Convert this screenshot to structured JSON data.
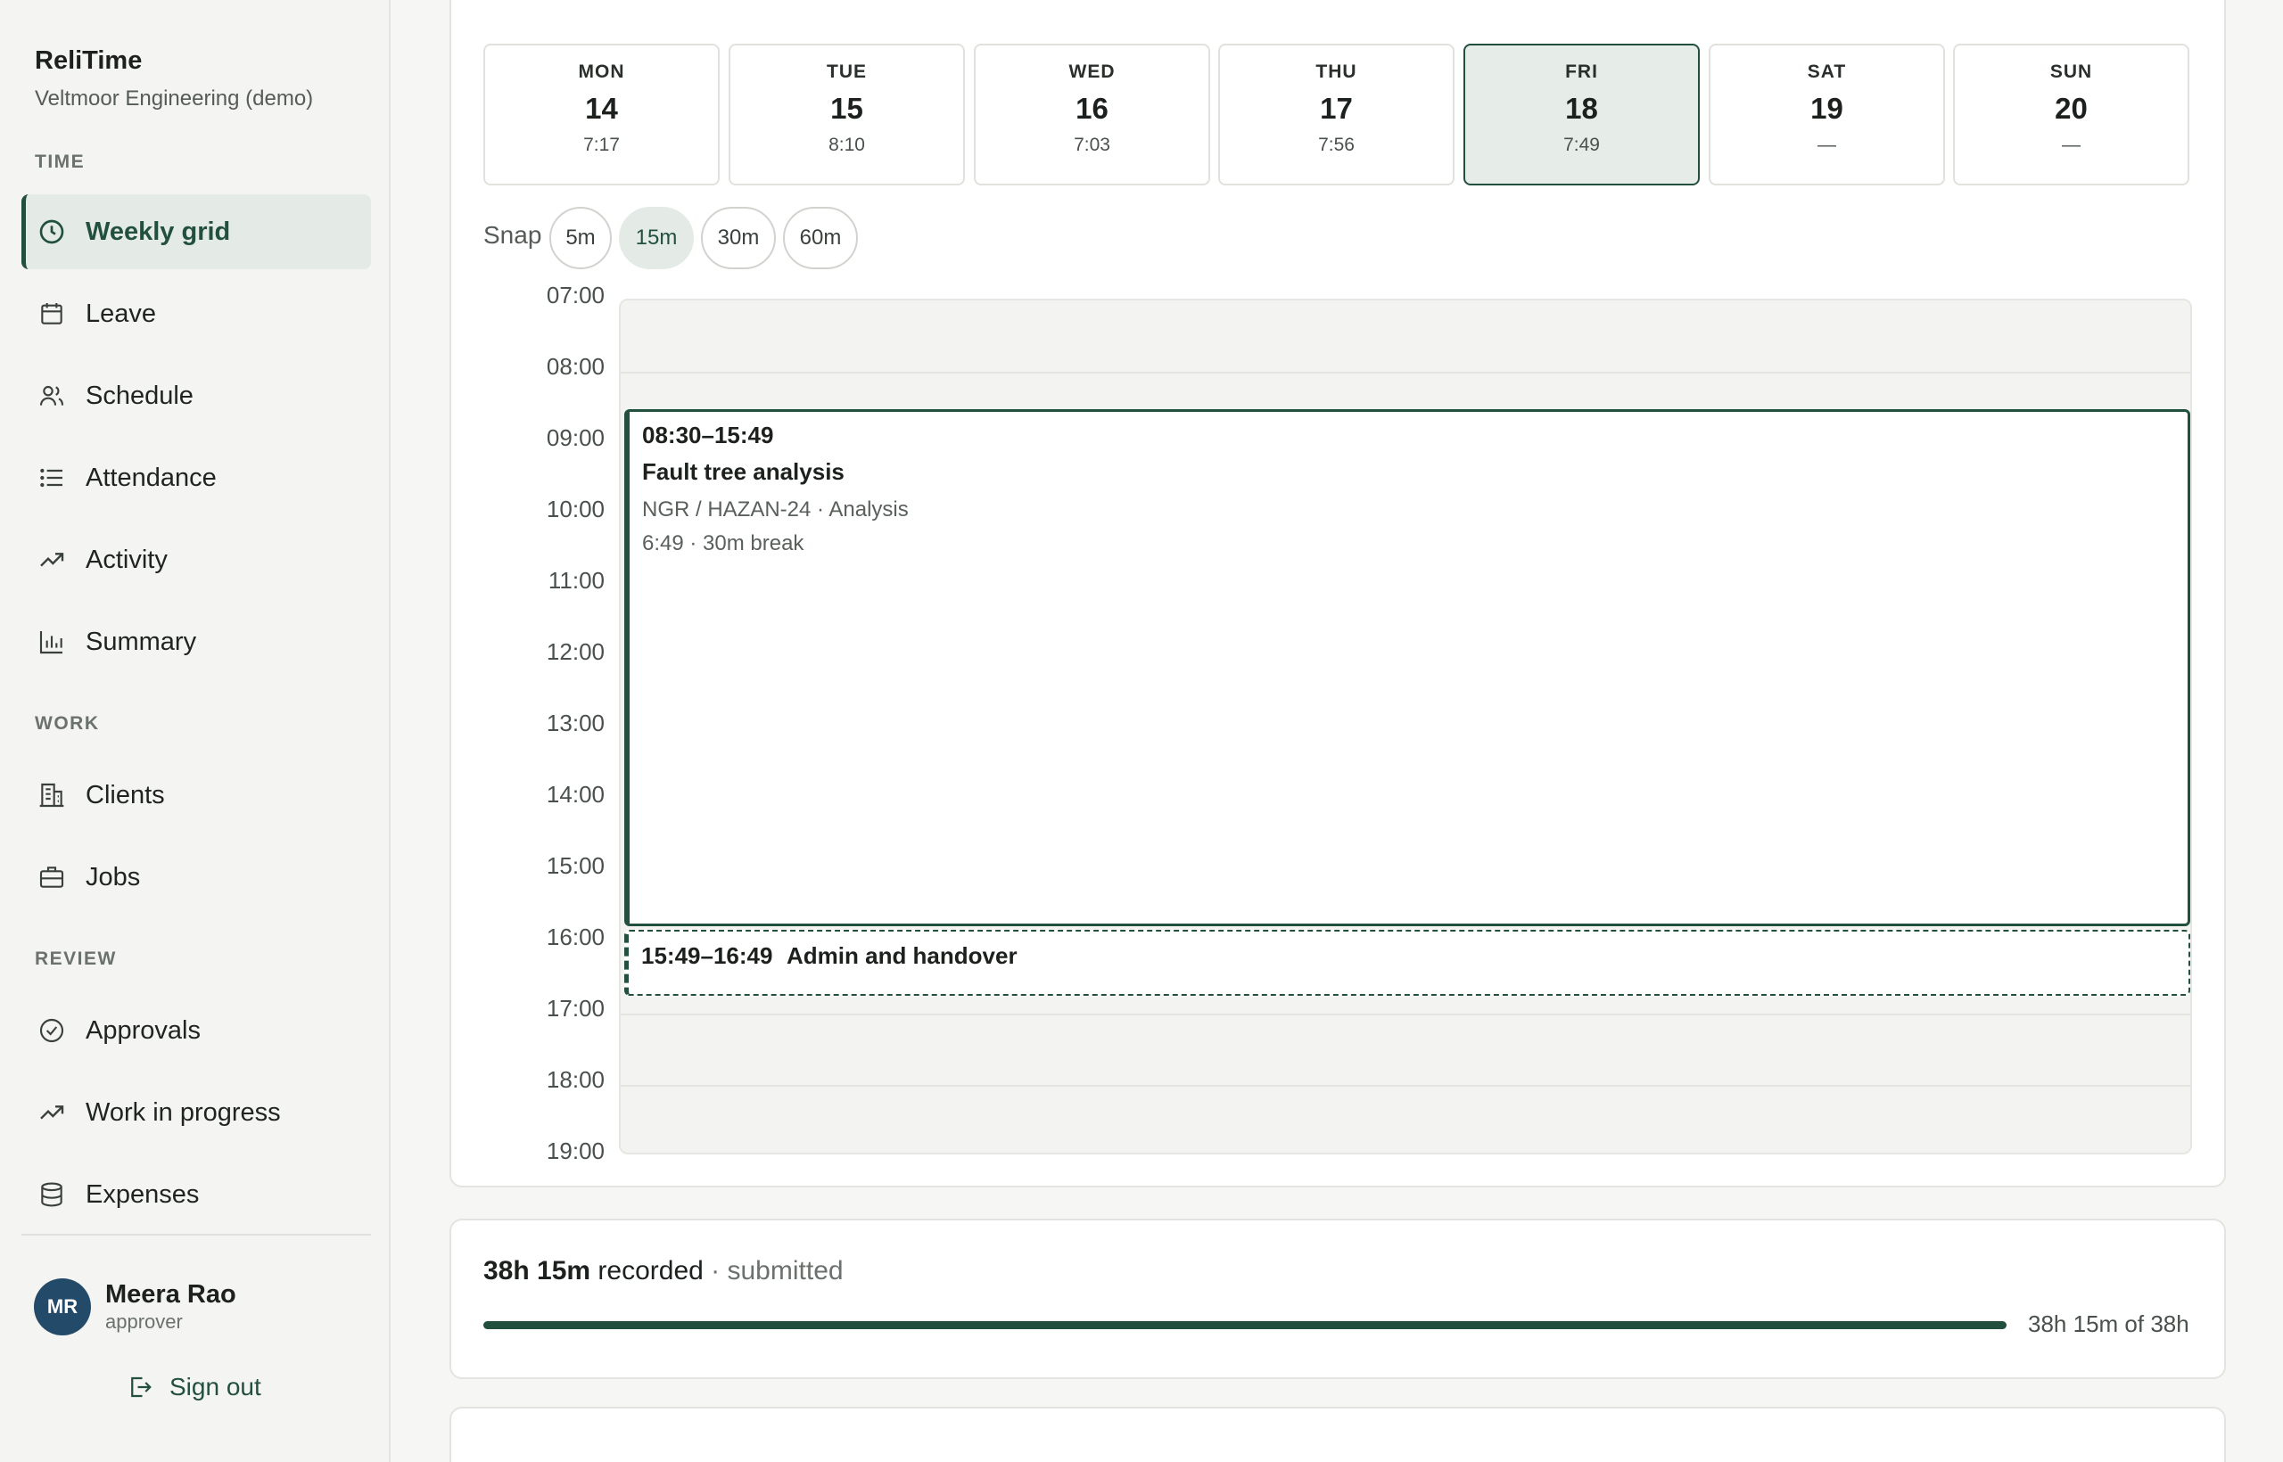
{
  "app": {
    "name": "ReliTime",
    "organization": "Veltmoor Engineering (demo)"
  },
  "sidebar": {
    "sections": [
      {
        "label": "TIME",
        "items": [
          {
            "label": "Weekly grid",
            "icon": "clock-icon",
            "active": true
          },
          {
            "label": "Leave",
            "icon": "calendar-icon"
          },
          {
            "label": "Schedule",
            "icon": "users-icon"
          },
          {
            "label": "Attendance",
            "icon": "list-icon"
          },
          {
            "label": "Activity",
            "icon": "trend-up-icon"
          },
          {
            "label": "Summary",
            "icon": "bar-chart-icon"
          }
        ]
      },
      {
        "label": "WORK",
        "items": [
          {
            "label": "Clients",
            "icon": "building-icon"
          },
          {
            "label": "Jobs",
            "icon": "briefcase-icon"
          }
        ]
      },
      {
        "label": "REVIEW",
        "items": [
          {
            "label": "Approvals",
            "icon": "check-circle-icon"
          },
          {
            "label": "Work in progress",
            "icon": "trend-up-icon"
          },
          {
            "label": "Expenses",
            "icon": "database-icon"
          }
        ]
      }
    ]
  },
  "user": {
    "initials": "MR",
    "name": "Meera Rao",
    "role": "approver",
    "signout_label": "Sign out"
  },
  "week": {
    "days": [
      {
        "name": "MON",
        "num": "14",
        "hours": "7:17"
      },
      {
        "name": "TUE",
        "num": "15",
        "hours": "8:10"
      },
      {
        "name": "WED",
        "num": "16",
        "hours": "7:03"
      },
      {
        "name": "THU",
        "num": "17",
        "hours": "7:56"
      },
      {
        "name": "FRI",
        "num": "18",
        "hours": "7:49",
        "active": true
      },
      {
        "name": "SAT",
        "num": "19",
        "hours": "—"
      },
      {
        "name": "SUN",
        "num": "20",
        "hours": "—"
      }
    ],
    "snap_label": "Snap",
    "snap_options": [
      "5m",
      "15m",
      "30m",
      "60m"
    ],
    "snap_selected": "15m",
    "time_labels": [
      "07:00",
      "08:00",
      "09:00",
      "10:00",
      "11:00",
      "12:00",
      "13:00",
      "14:00",
      "15:00",
      "16:00",
      "17:00",
      "18:00",
      "19:00"
    ]
  },
  "entries": {
    "main": {
      "time_range": "08:30–15:49",
      "title": "Fault tree analysis",
      "meta": "NGR / HAZAN-24 · Analysis",
      "duration": "6:49 · 30m break"
    },
    "gap": {
      "time_range": "15:49–16:49",
      "title": "Admin and handover"
    }
  },
  "totals": {
    "recorded": "38h 15m",
    "recorded_suffix": "recorded",
    "status": "· submitted",
    "progress_text": "38h 15m of 38h",
    "progress_fraction": 1.0
  },
  "colors": {
    "accent": "#23503e",
    "active_bg": "#e4ebe7",
    "avatar_bg": "#244a6a"
  }
}
